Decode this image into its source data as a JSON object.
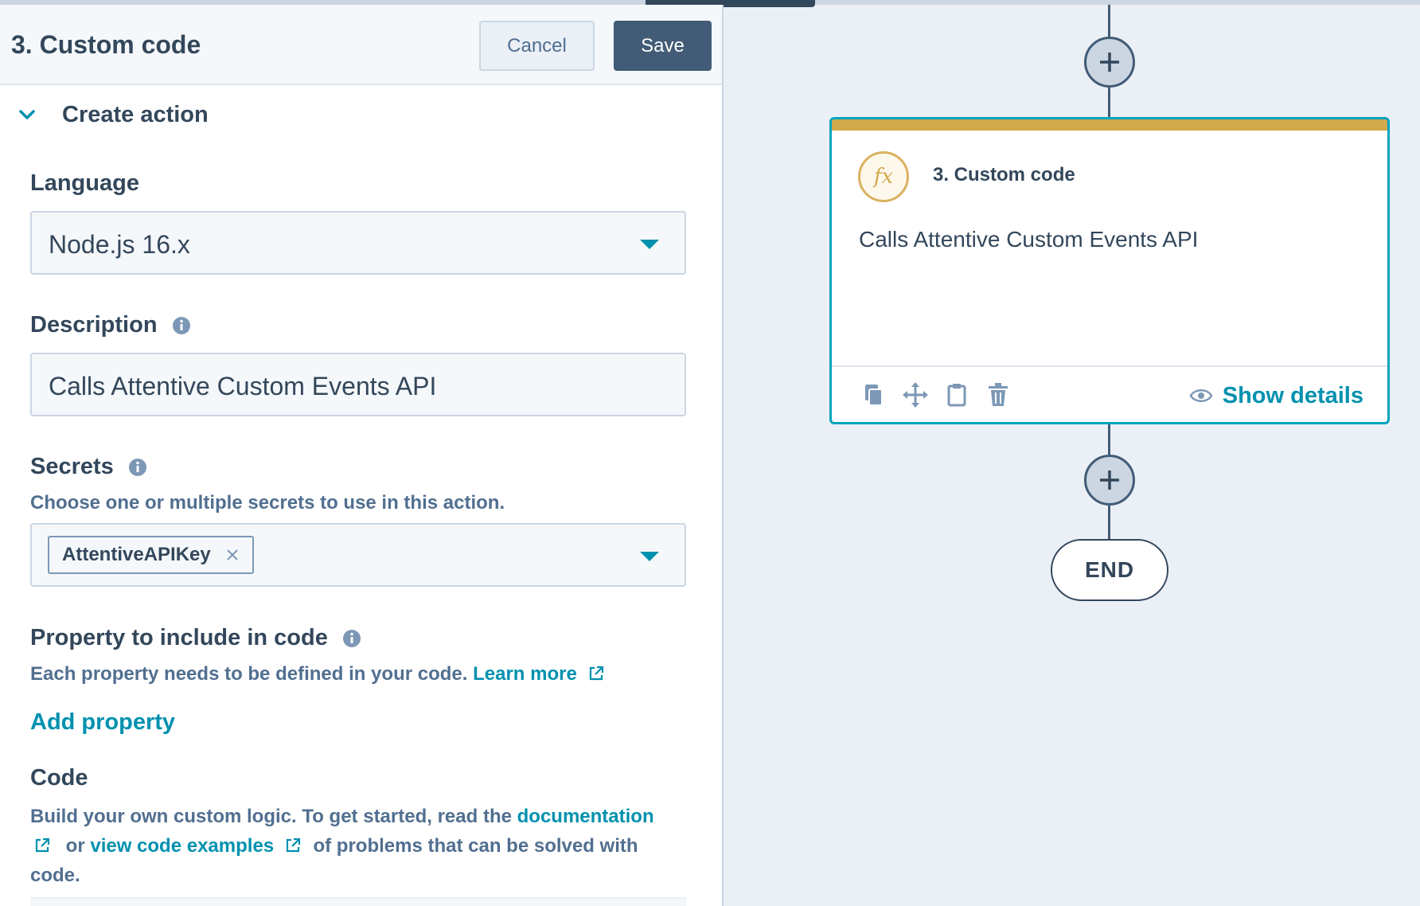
{
  "panel": {
    "title": "3. Custom code",
    "cancel_label": "Cancel",
    "save_label": "Save",
    "section_title": "Create action",
    "language": {
      "label": "Language",
      "value": "Node.js 16.x"
    },
    "description": {
      "label": "Description",
      "value": "Calls Attentive Custom Events API"
    },
    "secrets": {
      "label": "Secrets",
      "help": "Choose one or multiple secrets to use in this action.",
      "tags": [
        "AttentiveAPIKey"
      ]
    },
    "property": {
      "label": "Property to include in code",
      "help": "Each property needs to be defined in your code.",
      "learn_more": "Learn more",
      "add_property": "Add property"
    },
    "code": {
      "label": "Code",
      "help_1": "Build your own custom logic. To get started, read the",
      "documentation_link": "documentation",
      "help_2": "or",
      "examples_link": "view code examples",
      "help_3": "of problems that can be solved with",
      "help_4": "code."
    }
  },
  "canvas": {
    "card": {
      "icon_text": "fx",
      "title": "3. Custom code",
      "description": "Calls Attentive Custom Events API",
      "show_details": "Show details"
    },
    "end_label": "END"
  },
  "colors": {
    "accent": "#0091ae",
    "card_border": "#00a4bd",
    "card_stripe": "#d3a94d",
    "primary_button": "#425b76"
  },
  "icons": {
    "toggle": "chevron-down-icon",
    "info": "info-icon",
    "dropdown": "caret-down-icon",
    "tag_remove": "close-icon",
    "external": "external-link-icon",
    "add_step": "plus-icon",
    "card_tools": [
      "clone-icon",
      "move-icon",
      "clipboard-icon",
      "trash-icon"
    ],
    "show_details": "eye-icon"
  }
}
